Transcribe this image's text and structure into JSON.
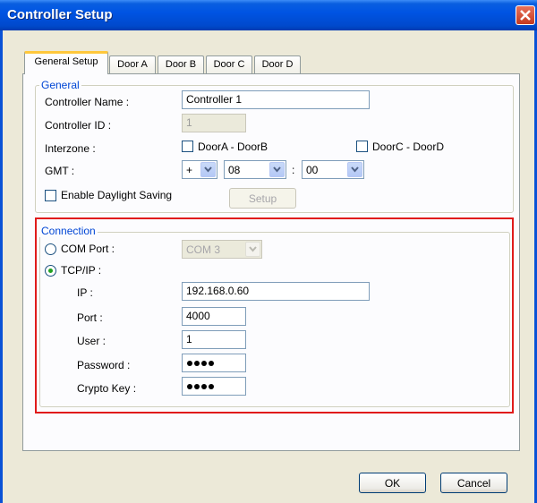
{
  "window": {
    "title": "Controller Setup"
  },
  "tabs": [
    "General Setup",
    "Door A",
    "Door B",
    "Door C",
    "Door D"
  ],
  "general": {
    "legend": "General",
    "controller_name_label": "Controller Name :",
    "controller_name_value": "Controller 1",
    "controller_id_label": "Controller ID :",
    "controller_id_value": "1",
    "interzone_label": "Interzone :",
    "interzone_ab_label": "DoorA - DoorB",
    "interzone_cd_label": "DoorC - DoorD",
    "gmt_label": "GMT :",
    "gmt_sign": "+",
    "gmt_hours": "08",
    "gmt_separator": ":",
    "gmt_minutes": "00",
    "daylight_label": "Enable Daylight Saving",
    "setup_button": "Setup"
  },
  "connection": {
    "legend": "Connection",
    "com_port_label": "COM Port :",
    "com_port_value": "COM 3",
    "tcpip_label": "TCP/IP :",
    "ip_label": "IP :",
    "ip_value": "192.168.0.60",
    "port_label": "Port :",
    "port_value": "4000",
    "user_label": "User :",
    "user_value": "1",
    "password_label": "Password :",
    "crypto_label": "Crypto Key :",
    "selected": "TCP/IP"
  },
  "buttons": {
    "ok": "OK",
    "cancel": "Cancel"
  },
  "colors": {
    "titlebar": "#0054e3",
    "highlight": "#e01b1b",
    "legend": "#0046d5",
    "dialog_bg": "#ece9d8"
  }
}
